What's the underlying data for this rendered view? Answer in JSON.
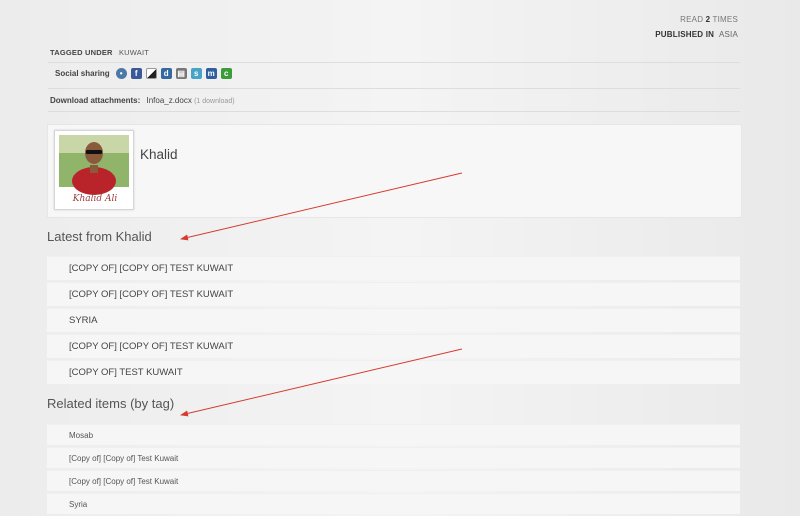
{
  "meta": {
    "read_pre": "READ",
    "read_count": "2",
    "read_post": "TIMES",
    "published_label": "PUBLISHED IN",
    "published_category": "ASIA"
  },
  "tags": {
    "label": "TAGGED UNDER",
    "items": [
      "KUWAIT"
    ]
  },
  "social": {
    "label": "Social sharing",
    "icons": [
      {
        "name": "chat-bubble-icon",
        "color": "#4a78a8"
      },
      {
        "name": "facebook-icon",
        "color": "#3b5998"
      },
      {
        "name": "delicious-icon",
        "color": "#222222"
      },
      {
        "name": "digg-icon",
        "color": "#356aa0"
      },
      {
        "name": "print-icon",
        "color": "#777777"
      },
      {
        "name": "stumbleupon-icon",
        "color": "#47a3c8"
      },
      {
        "name": "myspace-icon",
        "color": "#2f5fa0"
      },
      {
        "name": "share-c-icon",
        "color": "#3a9c3a"
      }
    ]
  },
  "download": {
    "label": "Download attachments:",
    "file": "Infoa_z.docx",
    "count": "(1 download)"
  },
  "author": {
    "name": "Khalid",
    "signature": "Khalid Ali"
  },
  "latest": {
    "title": "Latest from Khalid",
    "items": [
      "[COPY OF] [COPY OF] TEST KUWAIT",
      "[COPY OF] [COPY OF] TEST KUWAIT",
      "SYRIA",
      "[COPY OF] [COPY OF] TEST KUWAIT",
      "[COPY OF] TEST KUWAIT"
    ]
  },
  "related": {
    "title": "Related items (by tag)",
    "items": [
      "Mosab",
      "[Copy of] [Copy of] Test Kuwait",
      "[Copy of] [Copy of] Test Kuwait",
      "Syria"
    ]
  },
  "colors": {
    "arrow": "#d63a2f"
  }
}
